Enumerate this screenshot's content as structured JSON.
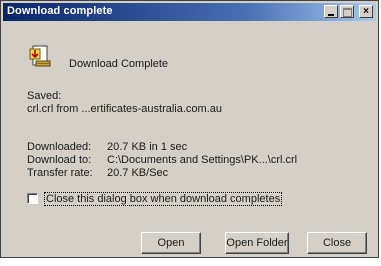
{
  "window": {
    "title": "Download complete"
  },
  "title_buttons": {
    "minimize_icon": "minimize-icon",
    "maximize_icon": "maximize-icon",
    "close_icon": "close-icon",
    "close_glyph": "×"
  },
  "header": {
    "icon": "file-download-icon",
    "message": "Download Complete"
  },
  "saved": {
    "label": "Saved:",
    "path": "crl.crl from ...ertificates-australia.com.au"
  },
  "details": [
    {
      "label": "Downloaded:",
      "value": "20.7 KB in 1 sec"
    },
    {
      "label": "Download to:",
      "value": "C:\\Documents and Settings\\PK...\\crl.crl"
    },
    {
      "label": "Transfer rate:",
      "value": "20.7 KB/Sec"
    }
  ],
  "close_dialog_option": {
    "label": "Close this dialog box when download completes",
    "checked": false
  },
  "buttons": {
    "open": "Open",
    "open_folder": "Open Folder",
    "close": "Close"
  },
  "colors": {
    "titlebar_start": "#0a246a",
    "titlebar_end": "#a6caf0",
    "dialog_face": "#d4d0c8"
  }
}
